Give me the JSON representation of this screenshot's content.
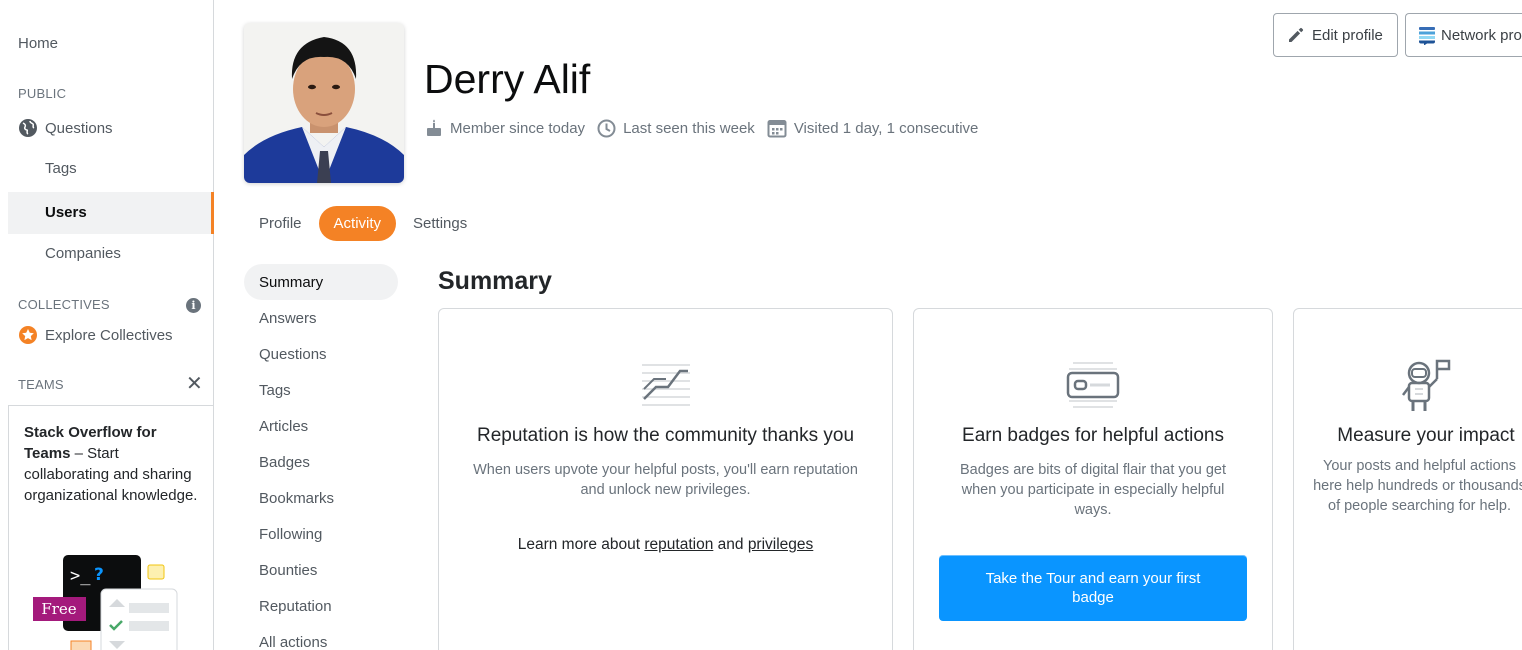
{
  "sidebar": {
    "home": "Home",
    "public_heading": "PUBLIC",
    "questions": "Questions",
    "tags": "Tags",
    "users": "Users",
    "companies": "Companies",
    "collectives_heading": "COLLECTIVES",
    "explore_collectives": "Explore Collectives",
    "teams_heading": "TEAMS",
    "teams_promo_bold": "Stack Overflow for Teams",
    "teams_promo_text": " – Start collaborating and sharing organizational knowledge.",
    "free_badge": "Free",
    "info_glyph": "i",
    "close_glyph": "✕"
  },
  "profile": {
    "name": "Derry Alif",
    "member_since": "Member since today",
    "last_seen": "Last seen this week",
    "visited": "Visited 1 day, 1 consecutive",
    "edit_profile": "Edit profile",
    "network_profile": "Network pro"
  },
  "tabs": [
    "Profile",
    "Activity",
    "Settings"
  ],
  "subnav": [
    "Summary",
    "Answers",
    "Questions",
    "Tags",
    "Articles",
    "Badges",
    "Bookmarks",
    "Following",
    "Bounties",
    "Reputation",
    "All actions"
  ],
  "summary": {
    "title": "Summary",
    "reputation": {
      "heading": "Reputation is how the community thanks you",
      "body": "When users upvote your helpful posts, you'll earn reputation and unlock new privileges.",
      "learn_prefix": "Learn more about ",
      "learn_link1": "reputation",
      "learn_and": " and ",
      "learn_link2": "privileges"
    },
    "badges": {
      "heading": "Earn badges for helpful actions",
      "body": "Badges are bits of digital flair that you get when you participate in especially helpful ways.",
      "button": "Take the Tour and earn your first badge"
    },
    "impact": {
      "heading": "Measure your impact",
      "body": "Your posts and helpful actions here help hundreds or thousands of people searching for help."
    }
  },
  "colors": {
    "accent": "#f48225",
    "primary_button": "#0a95ff"
  }
}
